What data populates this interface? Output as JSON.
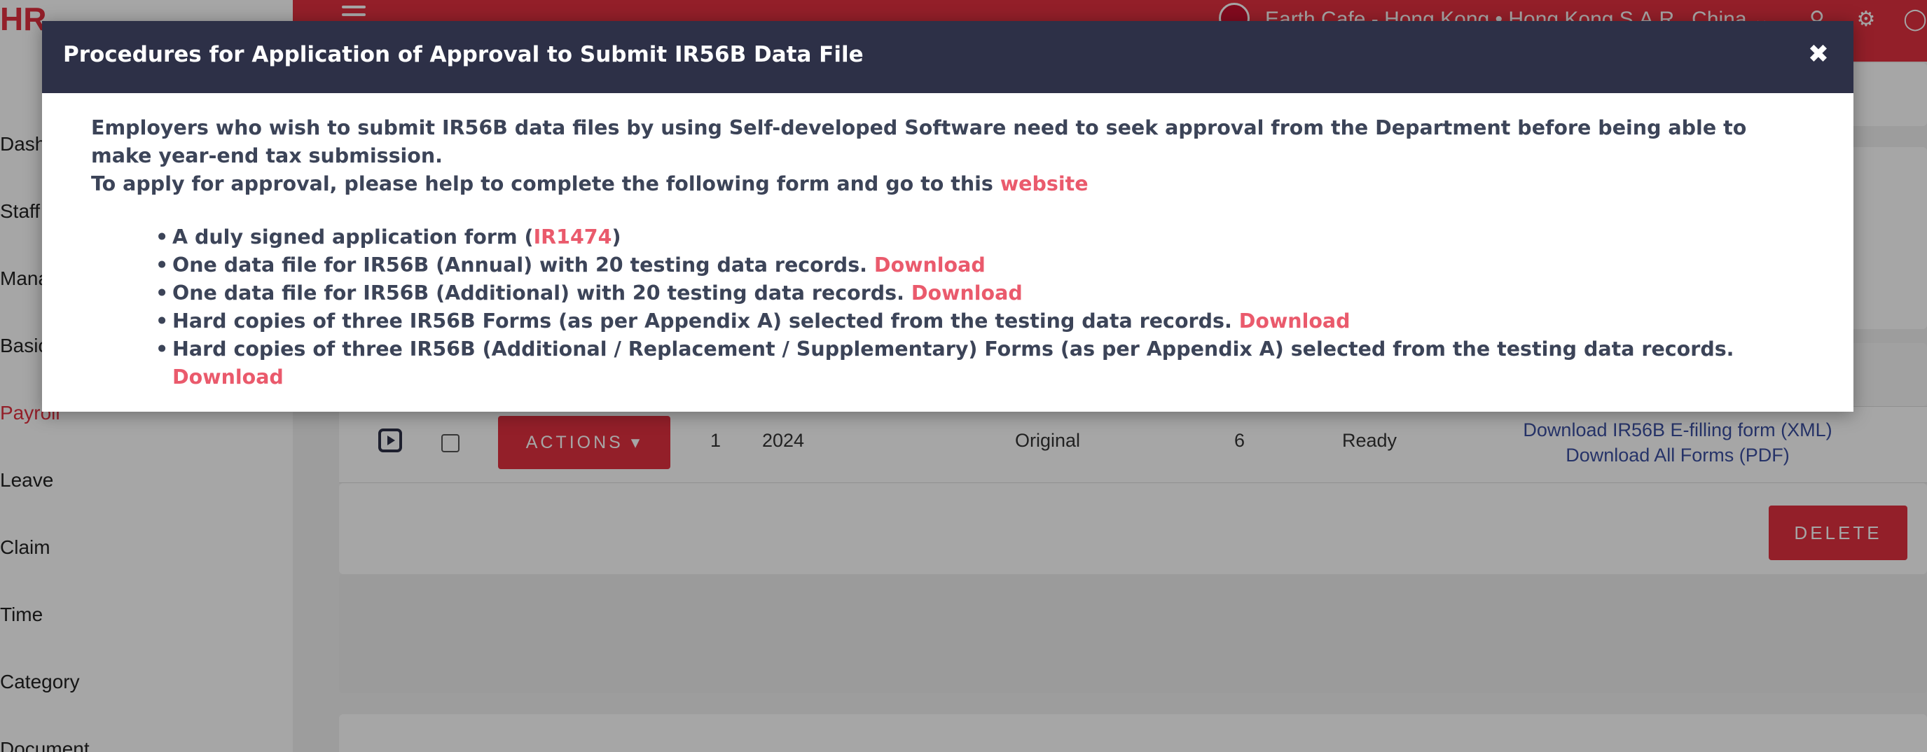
{
  "sidebar": {
    "logo": "HR",
    "logo_suffix": "",
    "items": [
      {
        "label": "Dash"
      },
      {
        "label": "Staff"
      },
      {
        "label": "Mana"
      },
      {
        "label": "Basic"
      },
      {
        "label": "Payroll"
      },
      {
        "label": "Leave"
      },
      {
        "label": "Claim"
      },
      {
        "label": "Time"
      },
      {
        "label": "Category"
      },
      {
        "label": "Document"
      }
    ]
  },
  "topbar": {
    "company": "Earth Cafe - Hong Kong • Hong Kong S.A.R., China",
    "user_icon": "user-icon",
    "settings_icon": "gear-icon",
    "chat_icon": "chat-icon"
  },
  "table_row": {
    "actions_label": "ACTIONS",
    "index": "1",
    "year": "2024",
    "type": "Original",
    "count": "6",
    "status": "Ready",
    "link_xml": "Download IR56B E-filling form (XML)",
    "link_pdf": "Download All Forms (PDF)"
  },
  "delete_label": "DELETE",
  "modal": {
    "title": "Procedures for Application of Approval to Submit IR56B Data File",
    "close_glyph": "✖",
    "intro_line1": "Employers who wish to submit IR56B data files by using Self-developed Software need to seek approval from the Department before being able to make year-end tax submission.",
    "intro_line2_prefix": "To apply for approval, please help to complete the following form and go to this ",
    "intro_line2_link": "website",
    "items": [
      {
        "text": "A duly signed application form (",
        "link": "IR1474",
        "suffix": ")"
      },
      {
        "text": "One data file for IR56B (Annual) with 20 testing data records. ",
        "link": "Download",
        "suffix": ""
      },
      {
        "text": "One data file for IR56B (Additional) with 20 testing data records. ",
        "link": "Download",
        "suffix": ""
      },
      {
        "text": "Hard copies of three IR56B Forms (as per Appendix A) selected from the testing data records. ",
        "link": "Download",
        "suffix": ""
      },
      {
        "text": "Hard copies of three IR56B (Additional / Replacement / Supplementary) Forms (as per Appendix A) selected from the testing data records. ",
        "link": "Download",
        "suffix": ""
      }
    ]
  }
}
